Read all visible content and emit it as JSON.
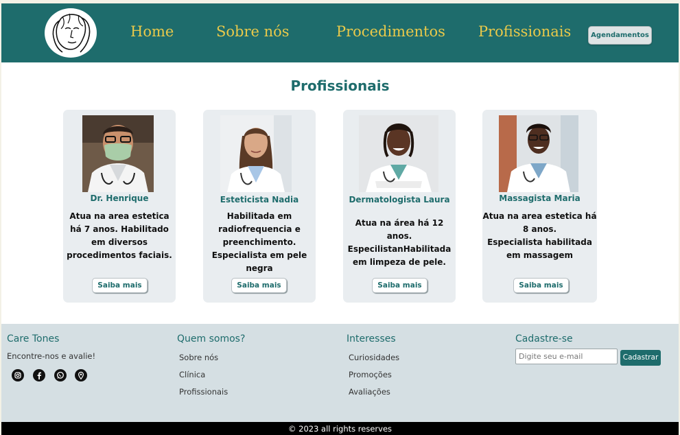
{
  "header": {
    "nav": [
      "Home",
      "Sobre nós",
      "Procedimentos",
      "Profissionais"
    ],
    "cta": "Agendamentos"
  },
  "main": {
    "title": "Profissionais",
    "cards": [
      {
        "name": "Dr. Henrique",
        "desc": [
          "Atua na area estetica",
          "há 7 anos. Habilitado",
          "em diversos",
          "procedimentos faciais."
        ],
        "button": "Saiba mais"
      },
      {
        "name": "Esteticista Nadia",
        "desc": [
          "Habilitada em",
          "radiofrequencia e",
          "preenchimento.",
          "Especialista em pele",
          "negra"
        ],
        "button": "Saiba mais"
      },
      {
        "name": "Dermatologista Laura",
        "desc": [
          "Atua na área há 12 anos.",
          "EspecilistanHabilitada",
          "em limpeza de pele."
        ],
        "button": "Saiba mais"
      },
      {
        "name": "Massagista Maria",
        "desc": [
          "Atua na area estetica há",
          "8 anos.",
          "Especialista habilitada",
          "em massagem"
        ],
        "button": "Saiba mais"
      }
    ]
  },
  "footer": {
    "brand": {
      "title": "Care Tones",
      "subtitle": "Encontre-nos e avalie!"
    },
    "social_icons": [
      "instagram-icon",
      "facebook-icon",
      "whatsapp-icon",
      "location-icon"
    ],
    "about": {
      "title": "Quem somos?",
      "links": [
        "Sobre nós",
        "Clínica",
        "Profissionais"
      ]
    },
    "interests": {
      "title": "Interesses",
      "links": [
        "Curiosidades",
        "Promoções",
        "Avaliações"
      ]
    },
    "signup": {
      "title": "Cadastre-se",
      "placeholder": "Digite seu e-mail",
      "button": "Cadastrar"
    },
    "copyright": "© 2023 all rights reserves"
  },
  "colors": {
    "primary_teal": "#1e6c6c",
    "nav_gold": "#e9c94a",
    "card_bg": "#e9edf0",
    "footer_bg": "#d5dfe3"
  }
}
